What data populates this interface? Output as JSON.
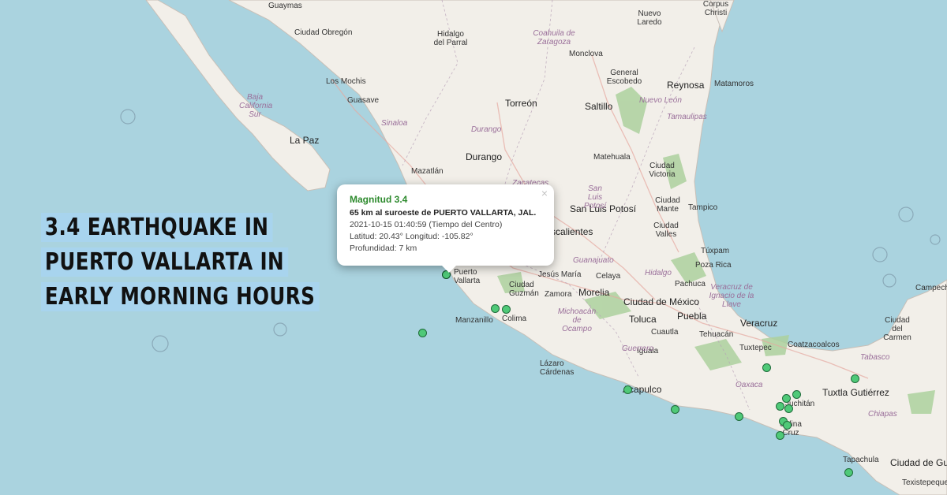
{
  "headline": {
    "lines": [
      "3.4 EARTHQUAKE IN",
      "PUERTO VALLARTA IN",
      "EARLY MORNING HOURS"
    ]
  },
  "popup": {
    "title": "Magnitud 3.4",
    "location": "65 km al suroeste de PUERTO VALLARTA, JAL.",
    "datetime": "2021-10-15  01:40:59 (Tiempo del Centro)",
    "coordinates": "Latitud: 20.43°  Longitud: -105.82°",
    "depth": "Profundidad: 7 km",
    "close_icon": "×"
  },
  "map": {
    "colors": {
      "water": "#aad3df",
      "land": "#f2efe9",
      "forest": "#add19e",
      "marker_fill": "#4fc978",
      "marker_stroke": "#1f6b3a",
      "popup_title": "#2d8a2d",
      "headline_bg": "#a8d4ee"
    },
    "labels": [
      {
        "text": "Guaymas"
      },
      {
        "text": "Ciudad Obregón"
      },
      {
        "text": "Los Mochis"
      },
      {
        "text": "Guasave"
      },
      {
        "text": "La Paz"
      },
      {
        "text": "Mazatlán"
      },
      {
        "text": "Durango"
      },
      {
        "text": "Torreón"
      },
      {
        "text": "Hidalgo del Parral"
      },
      {
        "text": "Monclova"
      },
      {
        "text": "Saltillo"
      },
      {
        "text": "General Escobedo"
      },
      {
        "text": "Reynosa"
      },
      {
        "text": "Matamoros"
      },
      {
        "text": "Nuevo Laredo"
      },
      {
        "text": "Corpus Christi"
      },
      {
        "text": "Matehuala"
      },
      {
        "text": "Ciudad Victoria"
      },
      {
        "text": "San Luis Potosí"
      },
      {
        "text": "Ciudad Mante"
      },
      {
        "text": "Tampico"
      },
      {
        "text": "Ciudad Valles"
      },
      {
        "text": "Aguascalientes"
      },
      {
        "text": "Túxpam"
      },
      {
        "text": "Poza Rica"
      },
      {
        "text": "Pachuca"
      },
      {
        "text": "Ciudad de México"
      },
      {
        "text": "Puebla"
      },
      {
        "text": "Toluca"
      },
      {
        "text": "Morelia"
      },
      {
        "text": "Celaya"
      },
      {
        "text": "Jesús María"
      },
      {
        "text": "Zamora"
      },
      {
        "text": "Ciudad Guzmán"
      },
      {
        "text": "Colima"
      },
      {
        "text": "Manzanillo"
      },
      {
        "text": "Puerto Vallarta"
      },
      {
        "text": "Veracruz"
      },
      {
        "text": "Tehuacán"
      },
      {
        "text": "Tuxtepec"
      },
      {
        "text": "Coatzacoalcos"
      },
      {
        "text": "Ciudad del Carmen"
      },
      {
        "text": "Campeche"
      },
      {
        "text": "Tuxtla Gutiérrez"
      },
      {
        "text": "Tapachula"
      },
      {
        "text": "Ciudad de Guatemala"
      },
      {
        "text": "Acapulco"
      },
      {
        "text": "Iguala"
      },
      {
        "text": "Cuautla"
      },
      {
        "text": "Lázaro Cárdenas"
      },
      {
        "text": "Juchitán"
      },
      {
        "text": "Salina Cruz"
      },
      {
        "text": "Texistepeque"
      }
    ],
    "regions": [
      {
        "text": "Baja California Sur"
      },
      {
        "text": "Sinaloa"
      },
      {
        "text": "Durango"
      },
      {
        "text": "Zacatecas"
      },
      {
        "text": "San Luis Potosí"
      },
      {
        "text": "Coahuila de Zaragoza"
      },
      {
        "text": "Nuevo León"
      },
      {
        "text": "Tamaulipas"
      },
      {
        "text": "Guanajuato"
      },
      {
        "text": "Hidalgo"
      },
      {
        "text": "Michoacán de Ocampo"
      },
      {
        "text": "Veracruz de Ignacio de la Llave"
      },
      {
        "text": "Guerrero"
      },
      {
        "text": "Oaxaca"
      },
      {
        "text": "Chiapas"
      },
      {
        "text": "Tabasco"
      }
    ],
    "earthquake_markers": 16
  }
}
